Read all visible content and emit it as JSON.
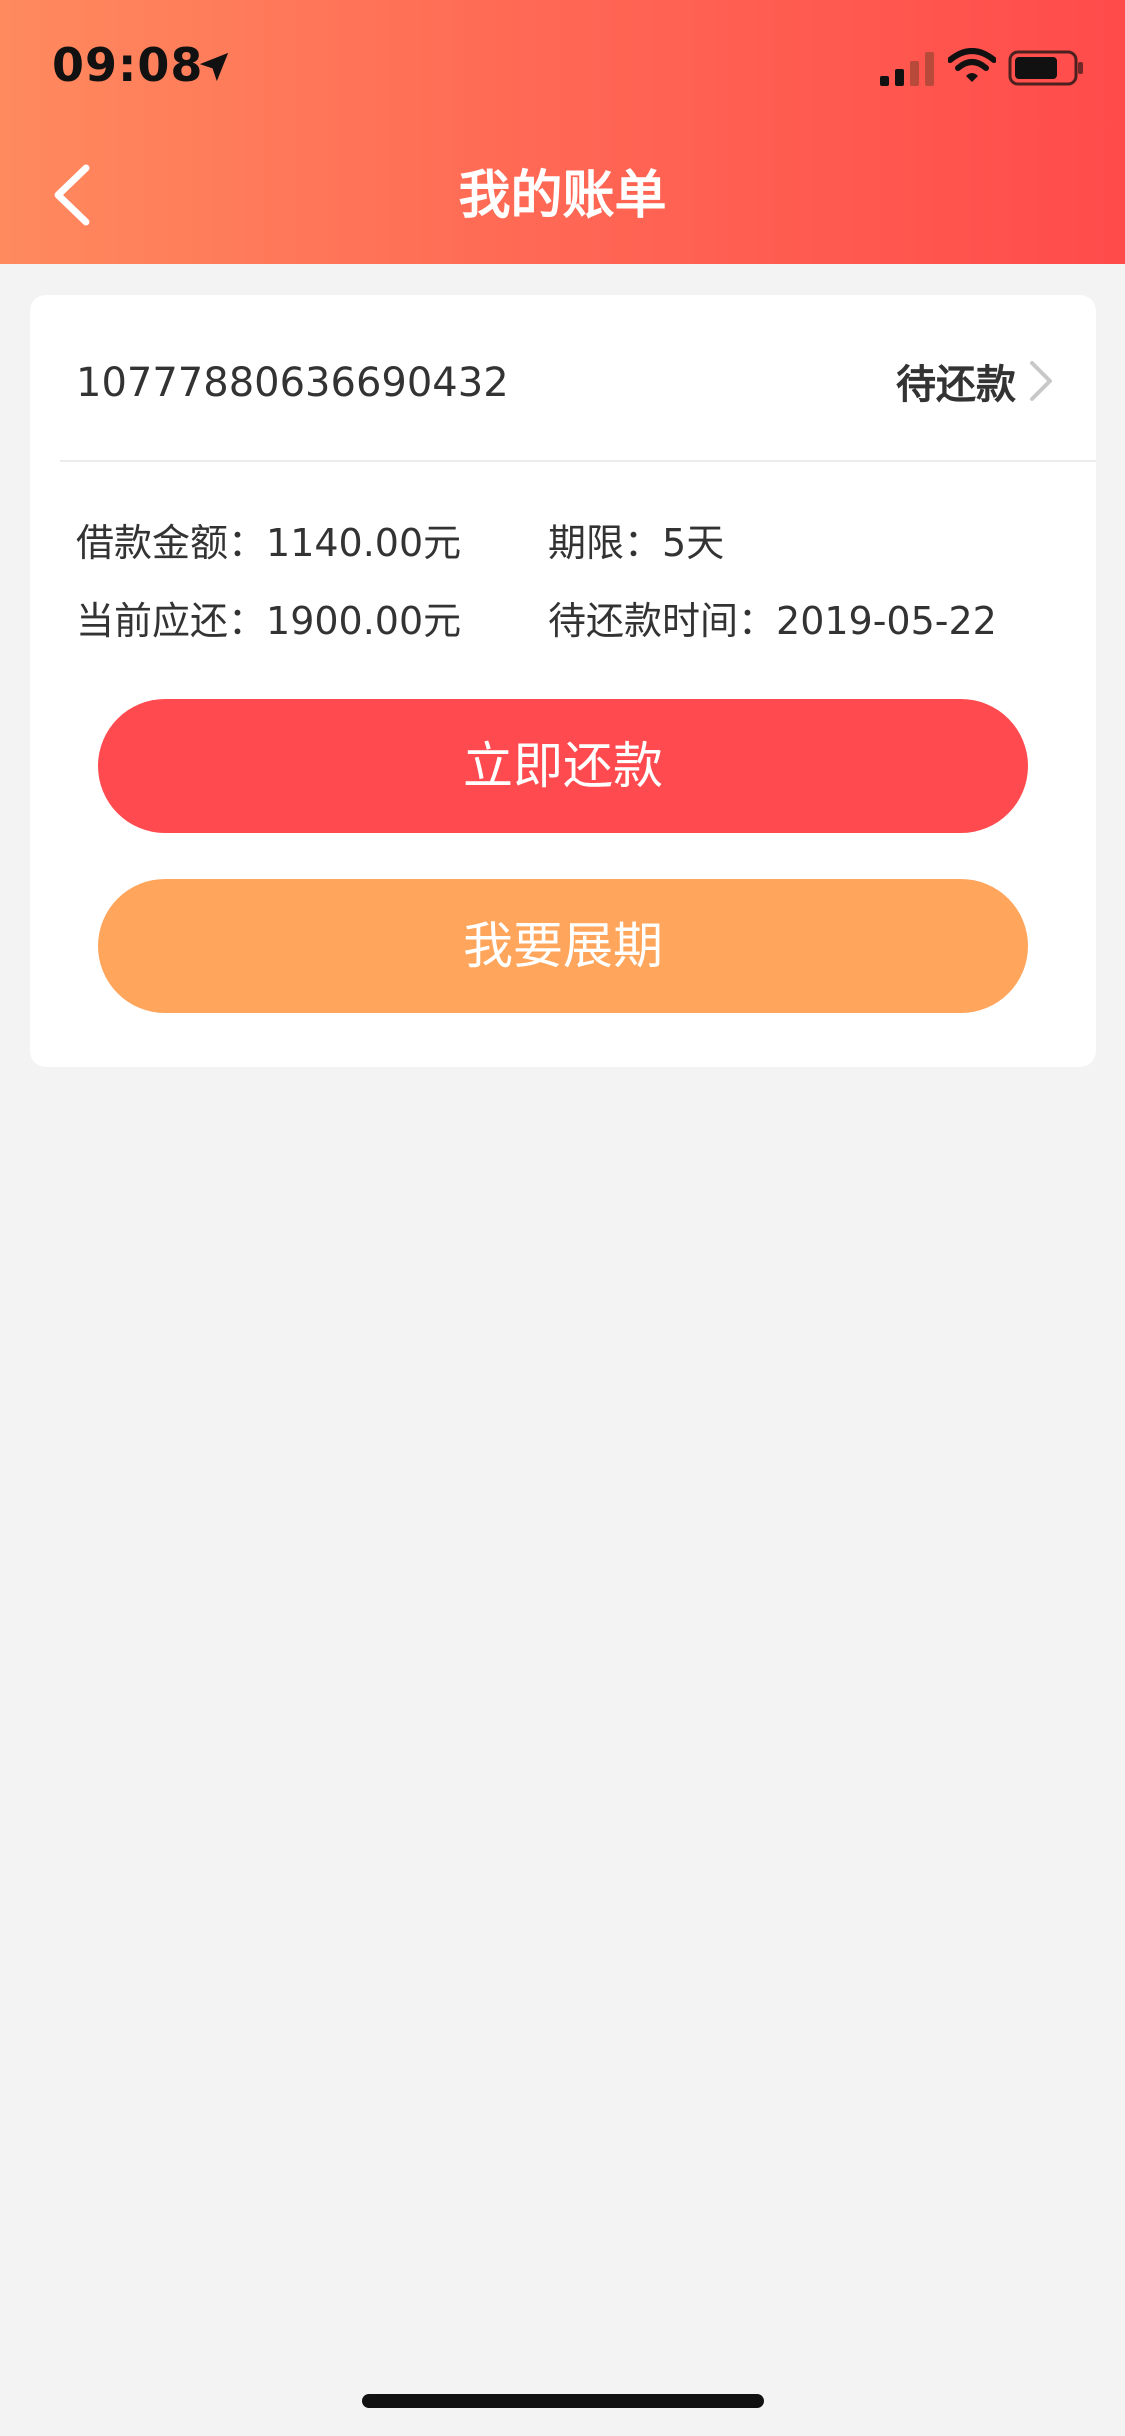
{
  "status_bar": {
    "time": "09:08",
    "location_icon": "location-arrow-icon",
    "signal_icon": "cellular-signal-icon",
    "wifi_icon": "wifi-icon",
    "battery_icon": "battery-icon"
  },
  "header": {
    "title": "我的账单",
    "back_icon": "chevron-left-icon",
    "gradient_start": "#ff8a5e",
    "gradient_end": "#ff4b4b"
  },
  "bill": {
    "number": "10777880636690432",
    "status": "待还款",
    "loan_amount_label": "借款金额：",
    "loan_amount_value": "1140.00元",
    "term_label": "期限：",
    "term_value": "5天",
    "current_due_label": "当前应还：",
    "current_due_value": "1900.00元",
    "due_time_label": "待还款时间：",
    "due_time_value": "2019-05-22"
  },
  "actions": {
    "repay_label": "立即还款",
    "repay_color": "#ff4b4f",
    "extend_label": "我要展期",
    "extend_color": "#ffa55c"
  }
}
